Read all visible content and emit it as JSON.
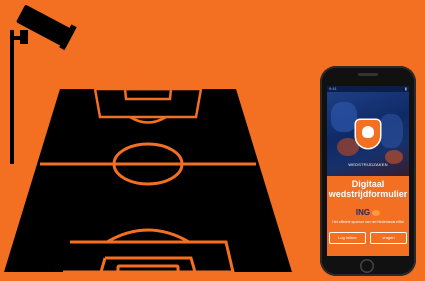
{
  "colors": {
    "background": "#f36f21",
    "pitch": "#000000",
    "pitch_lines": "#f36f21",
    "app_primary": "#f36f21",
    "app_navy": "#0f2a66"
  },
  "icons": {
    "camera": "security-camera-icon",
    "pitch": "football-pitch-icon",
    "phone": "smartphone-icon"
  },
  "app": {
    "status_time": "9:41",
    "hero_caption": "WEDSTRIJDZAKEN",
    "title_line1": "Digitaal",
    "title_line2": "wedstrijdformulier",
    "brand": "ING",
    "tagline": "Het officiele sponsor van het Nederlands elftal",
    "buttons": [
      {
        "label": "Log in/leer"
      },
      {
        "label": "vragen"
      }
    ]
  }
}
